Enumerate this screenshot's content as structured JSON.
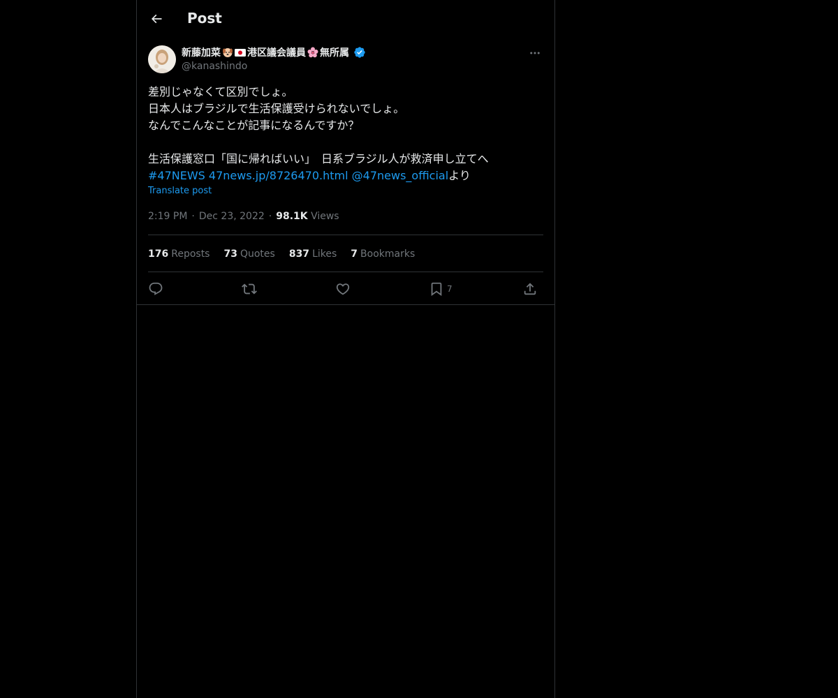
{
  "header": {
    "title": "Post"
  },
  "author": {
    "name_part1": "新藤加菜",
    "name_part2": "港区議会議員",
    "name_part3": "無所属",
    "handle": "@kanashindo",
    "verified_color": "#1d9bf0"
  },
  "post": {
    "lines": [
      "差別じゃなくて区別でしょ。",
      "日本人はブラジルで生活保護受けられないでしょ。",
      "なんでこんなことが記事になるんですか？",
      "",
      "生活保護窓口「国に帰ればいい」　日系ブラジル人が救済申し立てへ"
    ],
    "hashtag": "#47NEWS",
    "url": "47news.jp/8726470.html",
    "mention": "@47news_official",
    "suffix": "より",
    "translate_label": "Translate post"
  },
  "meta": {
    "time": "2:19 PM",
    "separator": "·",
    "date": "Dec 23, 2022",
    "views_count": "98.1K",
    "views_label": "Views"
  },
  "stats": {
    "reposts_count": "176",
    "reposts_label": "Reposts",
    "quotes_count": "73",
    "quotes_label": "Quotes",
    "likes_count": "837",
    "likes_label": "Likes",
    "bookmarks_count": "7",
    "bookmarks_label": "Bookmarks"
  },
  "actions": {
    "reply_icon": "reply-icon",
    "repost_icon": "repost-icon",
    "like_icon": "heart-icon",
    "bookmark_icon": "bookmark-icon",
    "bookmark_count": "7",
    "share_icon": "share-icon"
  },
  "colors": {
    "background": "#000000",
    "text": "#e7e9ea",
    "secondary": "#71767b",
    "accent": "#1d9bf0",
    "border": "#2f3336"
  }
}
